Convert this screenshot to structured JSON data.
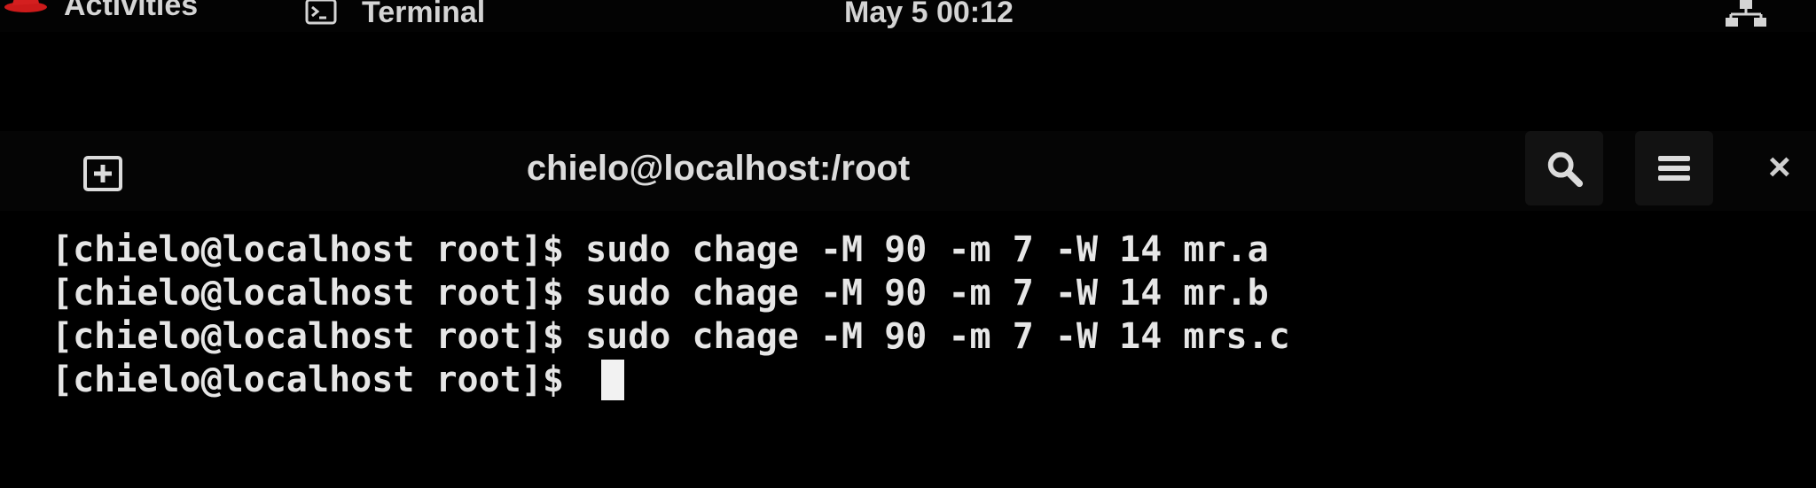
{
  "topbar": {
    "activities_label": "Activities",
    "app_name": "Terminal",
    "clock": "May 5  00:12",
    "icons": {
      "activities": "redhat-hat-icon",
      "app": "terminal-icon",
      "status": "network-icon"
    }
  },
  "terminal": {
    "title": "chielo@localhost:/root",
    "header_icons": {
      "new_tab": "new-tab-icon",
      "search": "search-icon",
      "menu": "hamburger-menu-icon",
      "close": "close-icon"
    },
    "close_glyph": "×",
    "prompt": "[chielo@localhost root]$ ",
    "lines": [
      {
        "command": "sudo chage -M 90 -m 7 -W 14 mr.a"
      },
      {
        "command": "sudo chage -M 90 -m 7 -W 14 mr.b"
      },
      {
        "command": "sudo chage -M 90 -m 7 -W 14 mrs.c"
      }
    ],
    "current_input": ""
  },
  "colors": {
    "background": "#000000",
    "text": "#e6e6e6",
    "redhat_red": "#cc1a1a",
    "header_button": "#121212"
  }
}
